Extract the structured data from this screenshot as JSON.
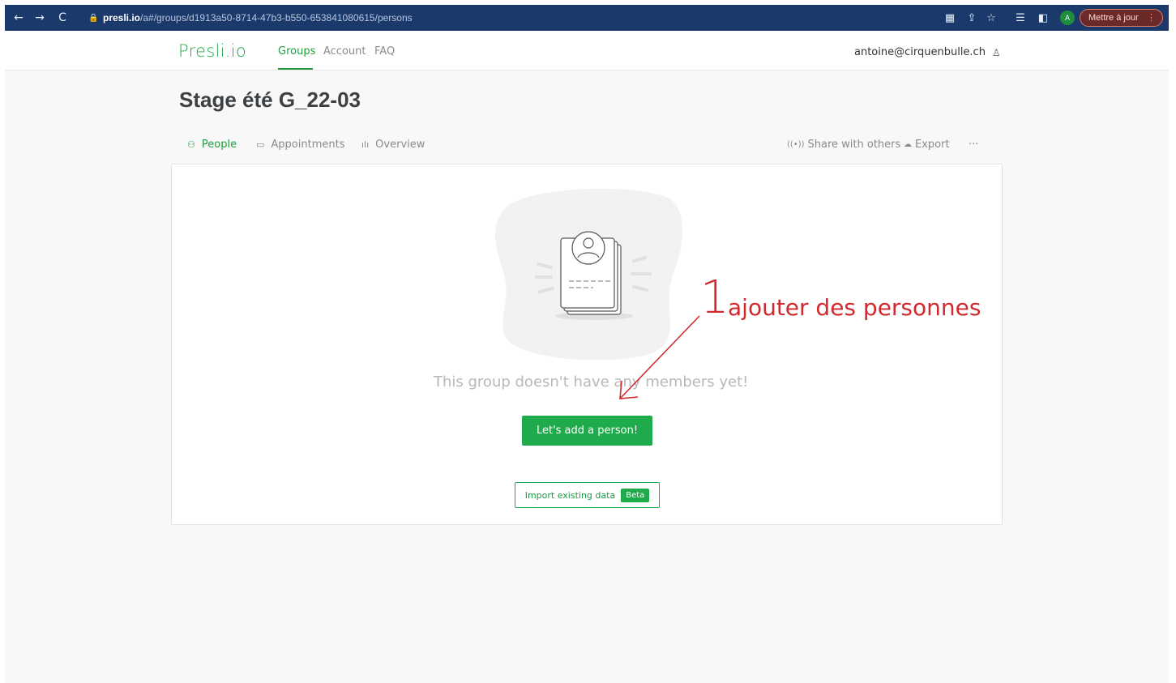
{
  "browser": {
    "url_host": "presli.io",
    "url_path": "/a#/groups/d1913a50-8714-47b3-b550-653841080615/persons",
    "profile_initial": "A",
    "update_label": "Mettre à jour"
  },
  "header": {
    "logo": "Presli.io",
    "nav": [
      "Groups",
      "Account",
      "FAQ"
    ],
    "user_email": "antoine@cirquenbulle.ch"
  },
  "page": {
    "title": "Stage été G_22-03",
    "tabs": [
      "People",
      "Appointments",
      "Overview"
    ],
    "actions": {
      "share": "Share with others",
      "export": "Export",
      "more": "···"
    }
  },
  "empty_state": {
    "message": "This group doesn't have any members yet!",
    "add_button": "Let's add a person!",
    "import_button": "Import existing data",
    "beta_badge": "Beta"
  },
  "annotation": {
    "number": "1",
    "text": "ajouter des personnes",
    "color": "#d0292e"
  },
  "colors": {
    "brand_green": "#1faa4b",
    "chrome_blue": "#1b3a6b"
  }
}
